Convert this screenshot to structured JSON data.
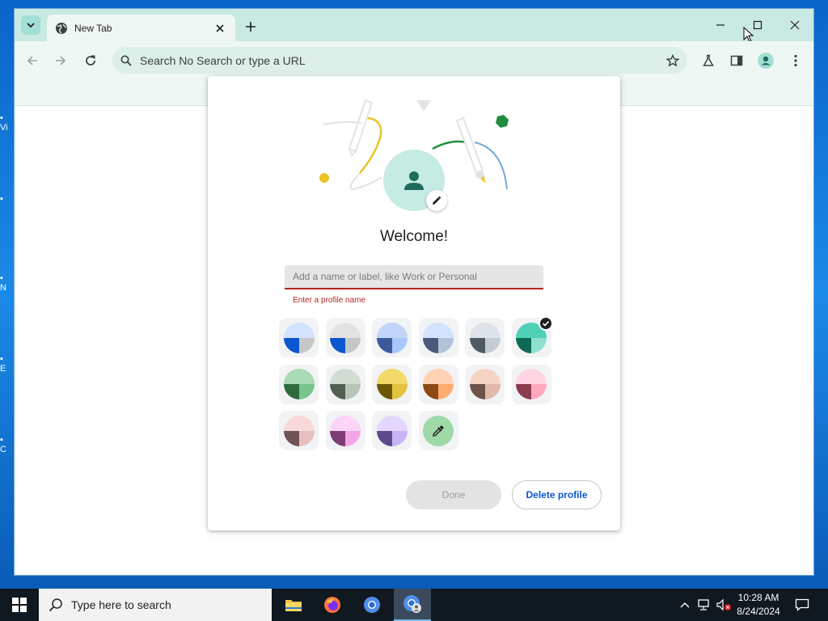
{
  "desktop": {
    "icon_labels": [
      "Vi",
      "N",
      "E",
      "C"
    ]
  },
  "browser": {
    "tab": {
      "title": "New Tab"
    },
    "omnibox": {
      "placeholder": "Search No Search or type a URL"
    }
  },
  "dialog": {
    "welcome": "Welcome!",
    "name_field": {
      "placeholder": "Add a name or label, like Work or Personal",
      "value": ""
    },
    "error": "Enter a profile name",
    "color_swatches": [
      {
        "top": "#d3e3fd",
        "bl": "#0b57d0",
        "br": "#c4c7c5",
        "selected": false
      },
      {
        "top": "#e3e3e3",
        "bl": "#0b57d0",
        "br": "#c4c7c5",
        "selected": false
      },
      {
        "top": "#c2d4f8",
        "bl": "#3c5a9a",
        "br": "#a8c7fa",
        "selected": false
      },
      {
        "top": "#d3e3fd",
        "bl": "#4a5a78",
        "br": "#b4c2d8",
        "selected": false
      },
      {
        "top": "#dde3e9",
        "bl": "#4f5b62",
        "br": "#c4ccd2",
        "selected": false
      },
      {
        "top": "#4fd1b5",
        "bl": "#0e6a55",
        "br": "#8ee0cc",
        "selected": true
      },
      {
        "top": "#a8dab5",
        "bl": "#2d6a3c",
        "br": "#7ac48e",
        "selected": false
      },
      {
        "top": "#d3dcd3",
        "bl": "#515e51",
        "br": "#b9c4b9",
        "selected": false
      },
      {
        "top": "#f2da6b",
        "bl": "#6b5800",
        "br": "#e3c23e",
        "selected": false
      },
      {
        "top": "#ffd2b5",
        "bl": "#8b4a12",
        "br": "#ffab70",
        "selected": false
      },
      {
        "top": "#f6d4c4",
        "bl": "#6d544a",
        "br": "#e0b9a8",
        "selected": false
      },
      {
        "top": "#ffd6e2",
        "bl": "#8b3a4f",
        "br": "#ffa9bf",
        "selected": false
      },
      {
        "top": "#f9d8da",
        "bl": "#6e5254",
        "br": "#e6bfc1",
        "selected": false
      },
      {
        "top": "#fcd4f6",
        "bl": "#7d3c76",
        "br": "#f2a6e6",
        "selected": false
      },
      {
        "top": "#e3d7ff",
        "bl": "#5b4a8c",
        "br": "#c7b5f7",
        "selected": false
      }
    ],
    "custom_color_icon": "eyedropper-icon",
    "done_label": "Done",
    "delete_label": "Delete profile"
  },
  "taskbar": {
    "search_placeholder": "Type here to search",
    "time": "10:28 AM",
    "date": "8/24/2024"
  },
  "colors": {
    "accent": "#0b57d0",
    "error": "#b3261e",
    "tabstrip": "#c9e9e3",
    "toolbar": "#eff7f5"
  }
}
